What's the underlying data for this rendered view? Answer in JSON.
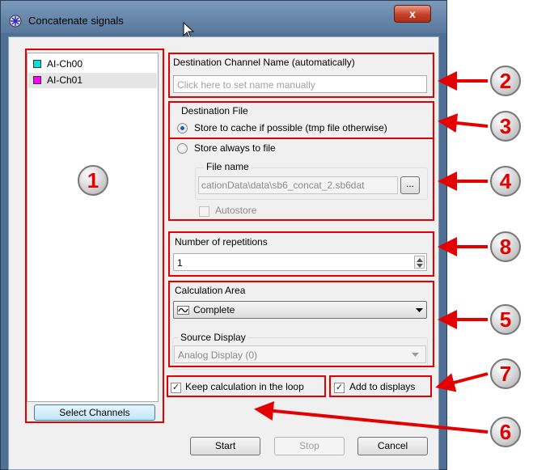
{
  "window": {
    "title": "Concatenate signals",
    "close_glyph": "x"
  },
  "channels": [
    {
      "label": "AI-Ch00",
      "color": "#00e0e0"
    },
    {
      "label": "AI-Ch01",
      "color": "#ff00ff"
    }
  ],
  "select_channels_label": "Select Channels",
  "destination_name": {
    "label": "Destination Channel Name (automatically)",
    "placeholder": "Click here to set name manually"
  },
  "destination_file": {
    "group_label": "Destination File",
    "option_cache": "Store to cache if possible (tmp file otherwise)",
    "option_file": "Store always to file",
    "file_name_label": "File name",
    "file_name_value": "cationData\\data\\sb6_concat_2.sb6dat",
    "browse_label": "...",
    "autostore_label": "Autostore"
  },
  "repetitions": {
    "label": "Number of repetitions",
    "value": "1"
  },
  "calculation_area": {
    "label": "Calculation Area",
    "selected": "Complete",
    "source_display_label": "Source Display",
    "source_display_value": "Analog Display (0)"
  },
  "keep_loop_label": "Keep calculation in the loop",
  "add_displays_label": "Add to displays",
  "buttons": {
    "start": "Start",
    "stop": "Stop",
    "cancel": "Cancel"
  },
  "callouts": [
    "1",
    "2",
    "3",
    "4",
    "8",
    "5",
    "7",
    "6"
  ],
  "annotation_color": "#e40000"
}
